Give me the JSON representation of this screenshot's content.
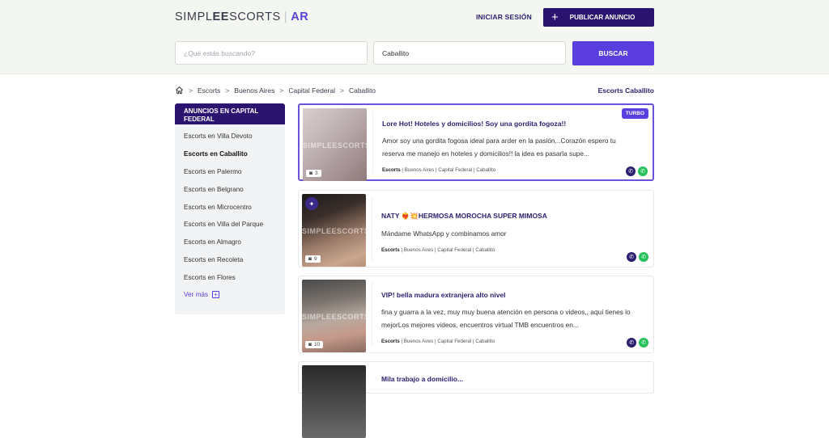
{
  "header": {
    "logo_simple": "SIMPL",
    "logo_ee": "EE",
    "logo_escorts": "SCORTS",
    "logo_sep": "|",
    "logo_country": "AR",
    "login_label": "INICIAR SESIÓN",
    "publish_label": "PUBLICAR ANUNCIO",
    "publish_icon": "+"
  },
  "search": {
    "placeholder": "¿Qué estás buscando?",
    "location_value": "Caballito",
    "button_label": "BUSCAR"
  },
  "breadcrumb": {
    "items": [
      "Escorts",
      "Buenos Aires",
      "Capital Federal",
      "Caballito"
    ],
    "separator": ">",
    "right_label": "Escorts Caballito"
  },
  "sidebar": {
    "heading": "ANUNCIOS EN CAPITAL FEDERAL",
    "items": [
      "Escorts en Villa Devoto",
      "Escorts en Caballito",
      "Escorts en Palermo",
      "Escorts en Belgrano",
      "Escorts en Microcentro",
      "Escorts en Villa del Parque",
      "Escorts en Almagro",
      "Escorts en Recoleta",
      "Escorts en Flores"
    ],
    "active_index": 1,
    "more_label": "Ver más",
    "more_icon": "+"
  },
  "listings": [
    {
      "title": "Lore Hot! Hoteles y domicilios! Soy una gordita fogoza!!",
      "desc_line1": "Amor soy una gordita fogosa ideal para arder en la pasión...Corazón espero tu",
      "desc_line2": "reserva me manejo en hoteles y domicilios!! la idea es pasarla supe...",
      "category": "Escorts",
      "location": " | Buenos Aires | Capital Federal | Caballito",
      "photos": "3",
      "badge": "TURBO",
      "watermark": "SIMPLEESCORTS"
    },
    {
      "title": "NATY ❤️‍🔥💥HERMOSA MOROCHA SUPER MIMOSA",
      "desc_line1": "Mándame WhatsApp y combinamos amor",
      "desc_line2": "",
      "category": "Escorts",
      "location": " | Buenos Aires | Capital Federal | Caballito",
      "photos": "9",
      "badge": "",
      "watermark": "SIMPLEESCORTS"
    },
    {
      "title": "VIP! bella madura extranjera alto nivel",
      "desc_line1": "fina y guarra a la vez, muy muy buena atención en persona o videos,, aquí tienes lo",
      "desc_line2": "mejorLos mejores videos, encuentros virtual TMB encuentros en...",
      "category": "Escorts",
      "location": " | Buenos Aires | Capital Federal | Caballito",
      "photos": "10",
      "badge": "",
      "watermark": "SIMPLEESCORTS"
    },
    {
      "title": "Mila trabajo a domicilio...",
      "desc_line1": "",
      "desc_line2": "",
      "category": "",
      "location": "",
      "photos": "",
      "badge": "",
      "watermark": ""
    }
  ],
  "colors": {
    "brand_dark": "#2a1470",
    "accent": "#5b3ee0",
    "whatsapp": "#25c05a"
  },
  "icons": [
    "home-icon",
    "camera-icon",
    "phone-icon",
    "whatsapp-icon",
    "pin-icon",
    "plus-icon"
  ]
}
